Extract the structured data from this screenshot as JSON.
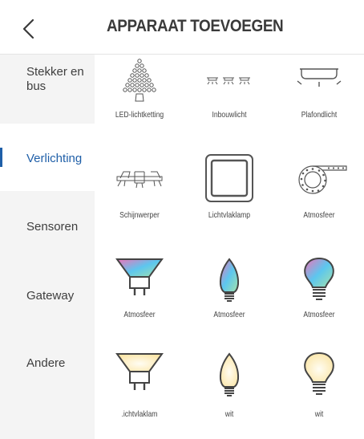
{
  "header": {
    "title": "APPARAAT TOEVOEGEN",
    "back_icon": "chevron-left-icon"
  },
  "sidebar": {
    "items": [
      {
        "label": "Stekker en bus",
        "active": false
      },
      {
        "label": "Verlichting",
        "active": true
      },
      {
        "label": "Sensoren",
        "active": false
      },
      {
        "label": "Gateway",
        "active": false
      },
      {
        "label": "Andere",
        "active": false
      }
    ]
  },
  "devices": [
    {
      "label": "LED-lichtketting",
      "icon": "led-string-icon"
    },
    {
      "label": "Inbouwlicht",
      "icon": "recessed-light-icon"
    },
    {
      "label": "Plafondlicht",
      "icon": "ceiling-light-icon"
    },
    {
      "label": "Schijnwerper",
      "icon": "spotlight-icon"
    },
    {
      "label": "Lichtvlaklamp",
      "icon": "light-panel-icon"
    },
    {
      "label": "Atmosfeer",
      "icon": "light-strip-icon"
    },
    {
      "label": "Atmosfeer",
      "icon": "rgb-spot-bulb-icon"
    },
    {
      "label": "Atmosfeer",
      "icon": "rgb-candle-bulb-icon"
    },
    {
      "label": "Atmosfeer",
      "icon": "rgb-bulb-icon"
    },
    {
      "label": ".ichtvlaklam",
      "icon": "white-spot-bulb-icon"
    },
    {
      "label": "wit",
      "icon": "white-candle-bulb-icon"
    },
    {
      "label": "wit",
      "icon": "white-bulb-icon"
    }
  ],
  "colors": {
    "accent": "#1f5fa8",
    "sidebar_bg": "#f4f4f4",
    "warm_white": "#fbe7ad"
  }
}
